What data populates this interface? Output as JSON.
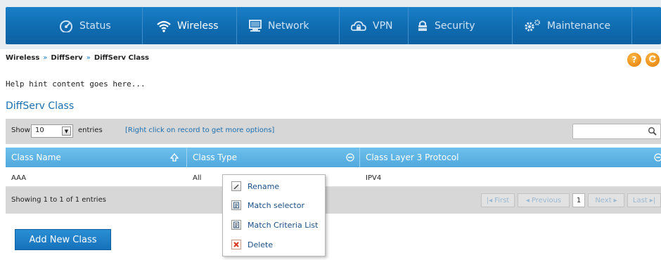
{
  "nav": {
    "items": [
      {
        "label": "Status",
        "icon": "speedometer-icon"
      },
      {
        "label": "Wireless",
        "icon": "wifi-icon"
      },
      {
        "label": "Network",
        "icon": "monitor-icon"
      },
      {
        "label": "VPN",
        "icon": "cloud-lock-icon"
      },
      {
        "label": "Security",
        "icon": "lock-icon"
      },
      {
        "label": "Maintenance",
        "icon": "gears-icon"
      }
    ],
    "active": "Wireless"
  },
  "breadcrumb": [
    "Wireless",
    "DiffServ",
    "DiffServ Class"
  ],
  "breadcrumb_separator": "»",
  "help_label": "?",
  "hint": "Help hint content goes here...",
  "page_title": "DiffServ Class",
  "toolbar": {
    "show_label": "Show",
    "entries_value": "10",
    "entries_label": "entries",
    "context_hint": "[Right click on record to get more options]",
    "search_value": ""
  },
  "table": {
    "columns": [
      "Class Name",
      "Class Type",
      "Class Layer 3 Protocol"
    ],
    "rows": [
      {
        "class_name": "AAA",
        "class_type": "All",
        "protocol": "IPV4"
      }
    ]
  },
  "footer": {
    "info": "Showing 1 to 1 of 1 entries",
    "first": "First",
    "previous": "Previous",
    "page": "1",
    "next": "Next",
    "last": "Last"
  },
  "add_button": "Add New Class",
  "context_menu": {
    "items": [
      {
        "label": "Rename",
        "icon": "pencil-icon"
      },
      {
        "label": "Match selector",
        "icon": "document-icon"
      },
      {
        "label": "Match Criteria List",
        "icon": "document-icon"
      },
      {
        "label": "Delete",
        "icon": "delete-x-icon"
      }
    ]
  },
  "colors": {
    "nav_blue": "#0f6bb0",
    "header_blue": "#4fa8dc",
    "title_blue": "#1a6fb0",
    "help_orange": "#e07a00",
    "delete_red": "#d83a2a"
  }
}
